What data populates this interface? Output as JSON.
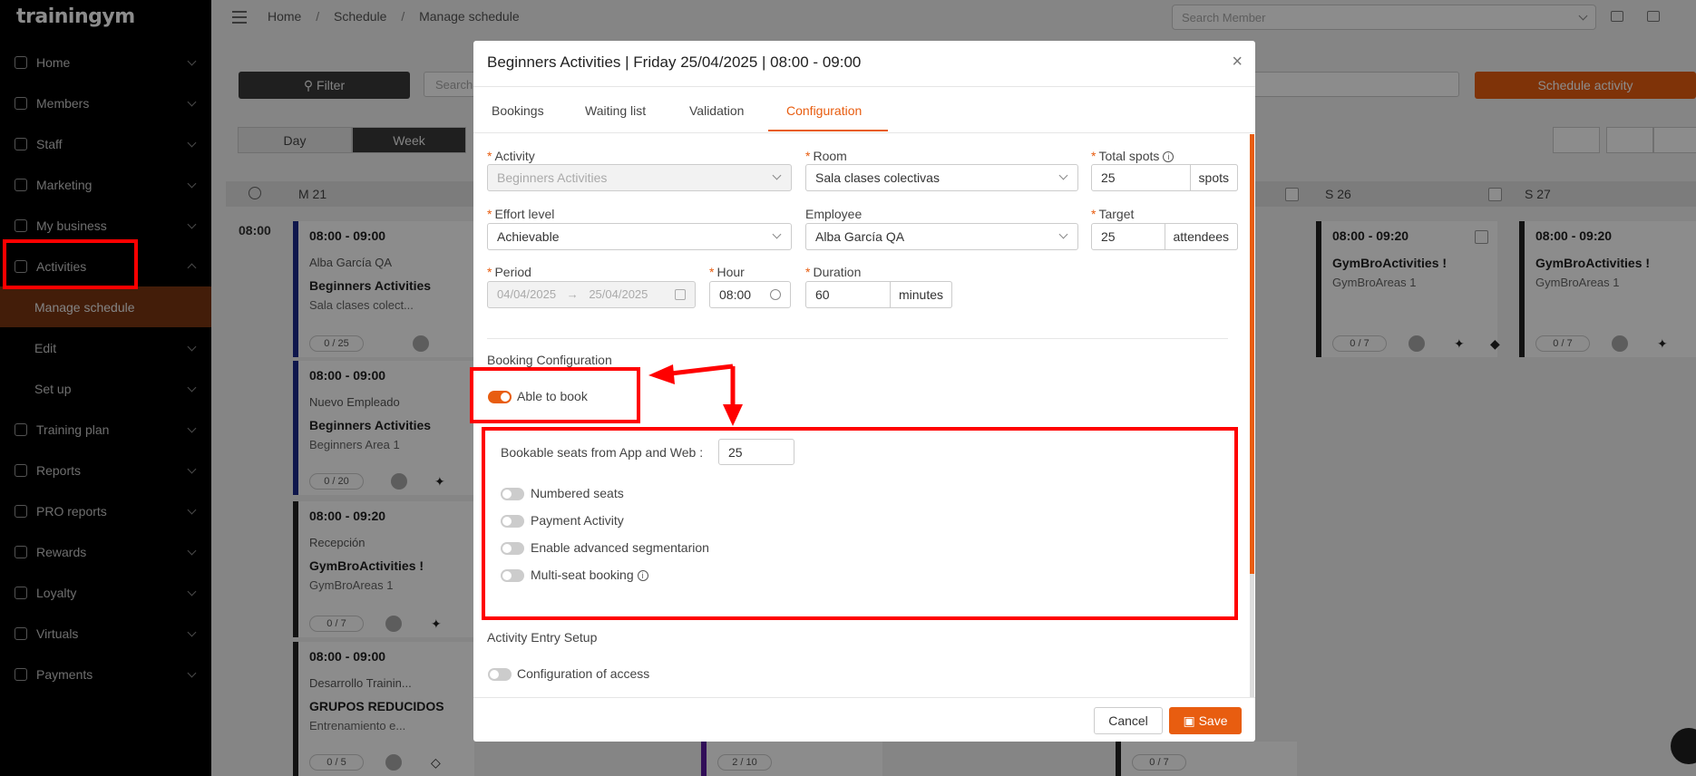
{
  "app": {
    "logo": "trainingym"
  },
  "sidebar": {
    "items": [
      {
        "label": "Home"
      },
      {
        "label": "Members"
      },
      {
        "label": "Staff"
      },
      {
        "label": "Marketing"
      },
      {
        "label": "My business"
      },
      {
        "label": "Activities"
      },
      {
        "label": "Manage schedule"
      },
      {
        "label": "Edit"
      },
      {
        "label": "Set up"
      },
      {
        "label": "Training plan"
      },
      {
        "label": "Reports"
      },
      {
        "label": "PRO reports"
      },
      {
        "label": "Rewards"
      },
      {
        "label": "Loyalty"
      },
      {
        "label": "Virtuals"
      },
      {
        "label": "Payments"
      }
    ]
  },
  "breadcrumb": {
    "home": "Home",
    "sep": "/",
    "schedule": "Schedule",
    "current": "Manage schedule"
  },
  "search_member": {
    "placeholder": "Search Member"
  },
  "toolbar": {
    "filter": "Filter",
    "search_placeholder": "Search",
    "schedule_activity": "Schedule activity",
    "day": "Day",
    "week": "Week"
  },
  "calendar": {
    "columns": [
      "M 21",
      "S 26",
      "S 27"
    ],
    "time": "08:00",
    "cards": [
      {
        "time": "08:00 - 09:00",
        "employee": "Alba García QA",
        "name": "Beginners Activities",
        "area": "Sala clases colect...",
        "spots": "0 / 25"
      },
      {
        "time": "08:00 - 09:00",
        "employee": "Nuevo Empleado",
        "name": "Beginners Activities",
        "area": "Beginners Area 1",
        "spots": "0 / 20"
      },
      {
        "time": "08:00 - 09:20",
        "employee": "Recepción",
        "name": "GymBroActivities !",
        "area": "GymBroAreas 1",
        "spots": "0 / 7"
      },
      {
        "time": "08:00 - 09:00",
        "employee": "Desarrollo Trainin...",
        "name": "GRUPOS REDUCIDOS",
        "area": "Entrenamiento e...",
        "spots": "0 / 5"
      },
      {
        "time": "08:00 - 09:20",
        "employee": "",
        "name": "GymBroActivities !",
        "area": "GymBroAreas 1",
        "spots": "0 / 7"
      },
      {
        "time": "08:00 - 09:20",
        "employee": "",
        "name": "GymBroActivities !",
        "area": "GymBroAreas 1",
        "spots": "0 / 7"
      }
    ],
    "partial_spots": [
      "2 / 10",
      "0 / 7"
    ]
  },
  "modal": {
    "title": "Beginners Activities | Friday 25/04/2025 | 08:00 - 09:00",
    "close": "×",
    "tabs": [
      "Bookings",
      "Waiting list",
      "Validation",
      "Configuration"
    ],
    "active_tab": "Configuration",
    "fields": {
      "activity": {
        "label": "Activity",
        "value": "Beginners Activities"
      },
      "room": {
        "label": "Room",
        "value": "Sala clases colectivas"
      },
      "total_spots": {
        "label": "Total spots",
        "value": "25",
        "unit": "spots"
      },
      "effort": {
        "label": "Effort level",
        "value": "Achievable"
      },
      "employee": {
        "label": "Employee",
        "value": "Alba García QA"
      },
      "target": {
        "label": "Target",
        "value": "25",
        "unit": "attendees"
      },
      "period": {
        "label": "Period",
        "from": "04/04/2025",
        "arrow": "→",
        "to": "25/04/2025"
      },
      "hour": {
        "label": "Hour",
        "value": "08:00"
      },
      "duration": {
        "label": "Duration",
        "value": "60",
        "unit": "minutes"
      }
    },
    "booking_config": {
      "heading": "Booking Configuration",
      "able_to_book": "Able to book",
      "bookable_seats_label": "Bookable seats from App and Web :",
      "bookable_seats_value": "25",
      "toggles": [
        "Numbered seats",
        "Payment Activity",
        "Enable advanced segmentarion",
        "Multi-seat booking"
      ]
    },
    "entry_setup": {
      "heading": "Activity Entry Setup",
      "config_access": "Configuration of access"
    },
    "buttons": {
      "cancel": "Cancel",
      "save": "Save"
    }
  },
  "colors": {
    "accent": "#e85d10",
    "annotation": "#ff0000",
    "sidebar_bg": "#000000"
  }
}
